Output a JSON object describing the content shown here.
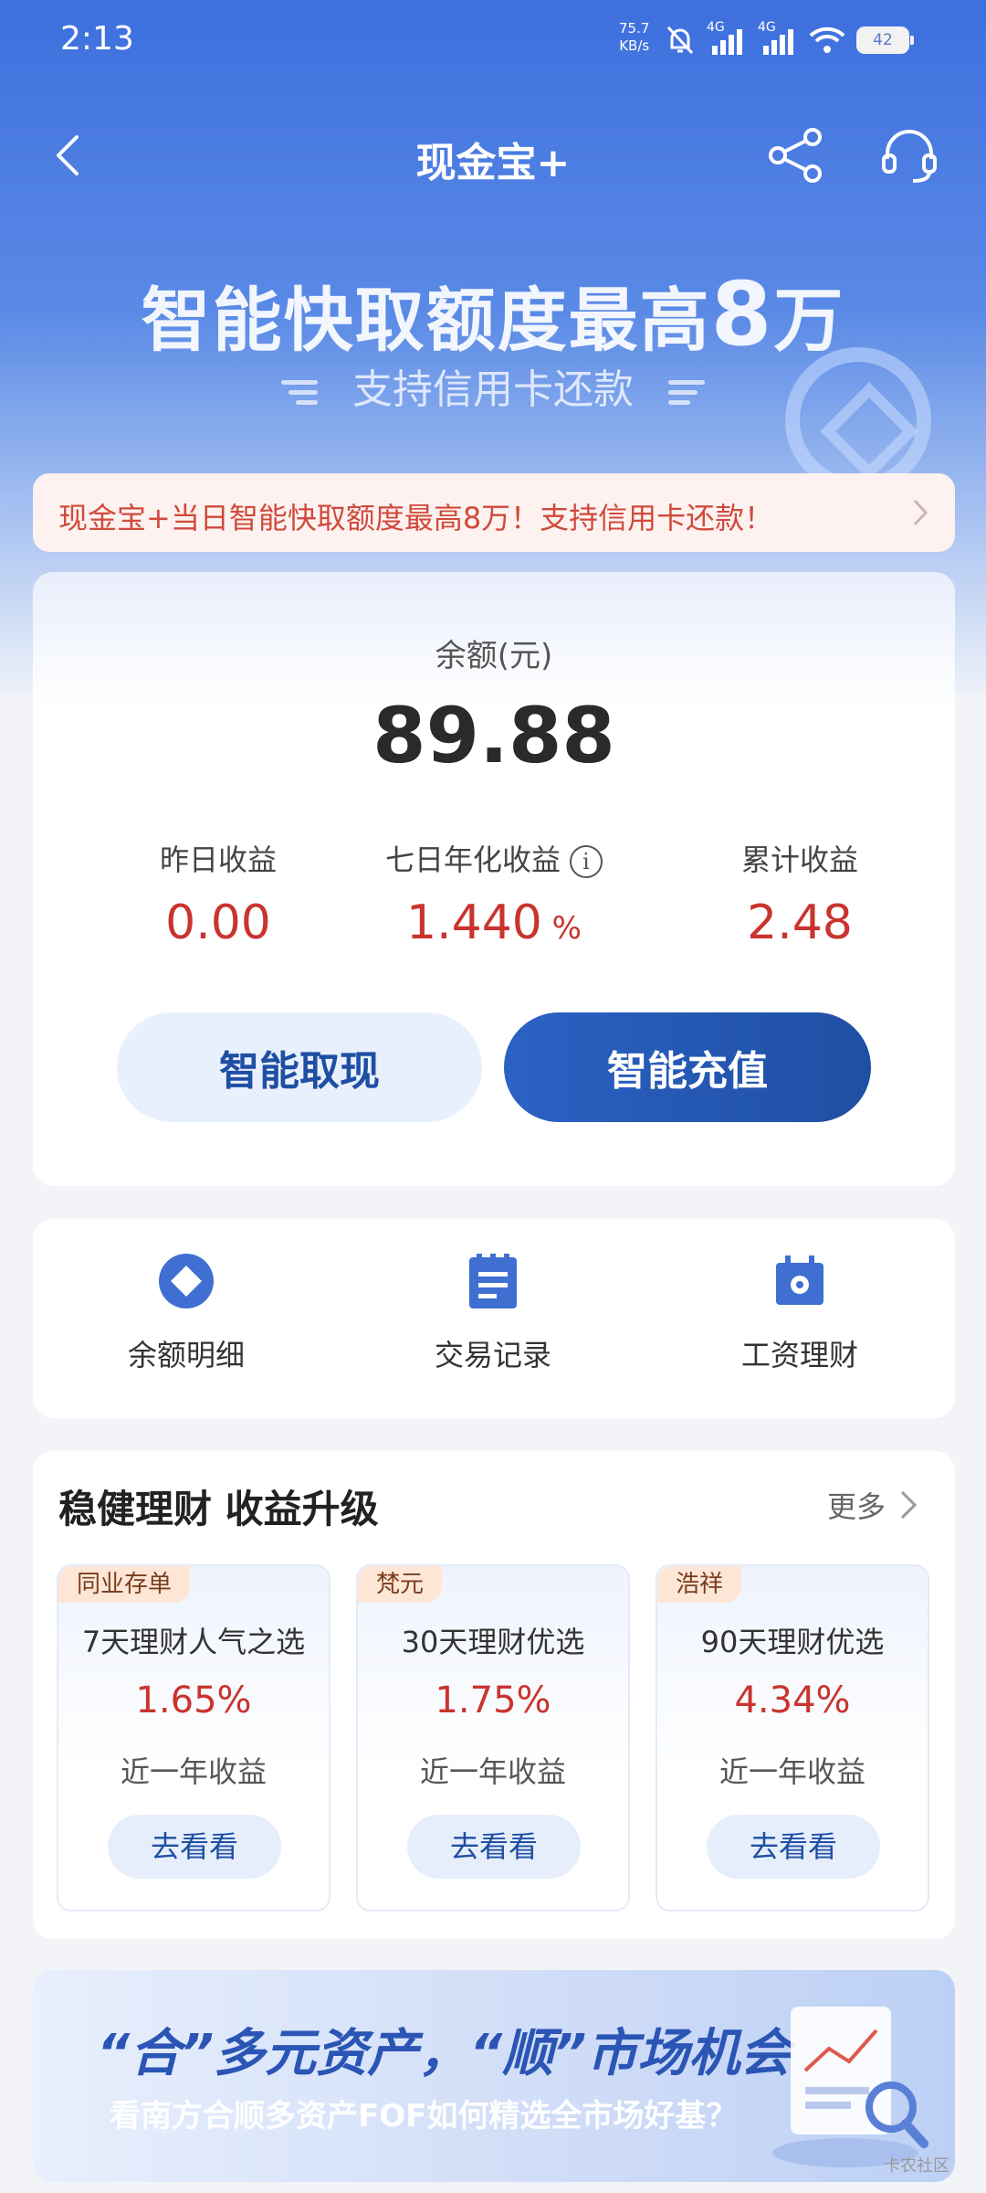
{
  "status": {
    "time": "2:13",
    "net_speed_value": "75.7",
    "net_speed_unit": "KB/s",
    "battery": "42",
    "signal1": "4G",
    "signal2": "4G"
  },
  "nav": {
    "title": "现金宝+"
  },
  "banner": {
    "headline_prefix": "智能快取额度最高",
    "headline_num": "8",
    "headline_suffix": "万",
    "subline": "支持信用卡还款"
  },
  "notice": {
    "text": "现金宝+当日智能快取额度最高8万！支持信用卡还款！"
  },
  "balance": {
    "label": "余额(元)",
    "value": "89.88",
    "stats": [
      {
        "label": "昨日收益",
        "value": "0.00",
        "unit": ""
      },
      {
        "label": "七日年化收益",
        "value": "1.440",
        "unit": " %"
      },
      {
        "label": "累计收益",
        "value": "2.48",
        "unit": ""
      }
    ],
    "withdraw_label": "智能取现",
    "recharge_label": "智能充值"
  },
  "actions": [
    {
      "label": "余额明细",
      "icon": "diamond-icon"
    },
    {
      "label": "交易记录",
      "icon": "document-icon"
    },
    {
      "label": "工资理财",
      "icon": "wallet-icon"
    }
  ],
  "wealth": {
    "title": "稳健理财 收益升级",
    "more_label": "更多",
    "products": [
      {
        "tag": "同业存单",
        "name": "7天理财人气之选",
        "rate": "1.65%",
        "desc": "近一年收益",
        "cta": "去看看"
      },
      {
        "tag": "梵元",
        "name": "30天理财优选",
        "rate": "1.75%",
        "desc": "近一年收益",
        "cta": "去看看"
      },
      {
        "tag": "浩祥",
        "name": "90天理财优选",
        "rate": "4.34%",
        "desc": "近一年收益",
        "cta": "去看看"
      }
    ]
  },
  "ad": {
    "title": "“合”多元资产，“顺”市场机会",
    "subtitle": "看南方合顺多资产FOF如何精选全市场好基？",
    "watermark": "卡农社区"
  },
  "colors": {
    "primary": "#1e4fa3",
    "accent_red": "#c9342e",
    "hero_blue": "#3d6fde"
  }
}
